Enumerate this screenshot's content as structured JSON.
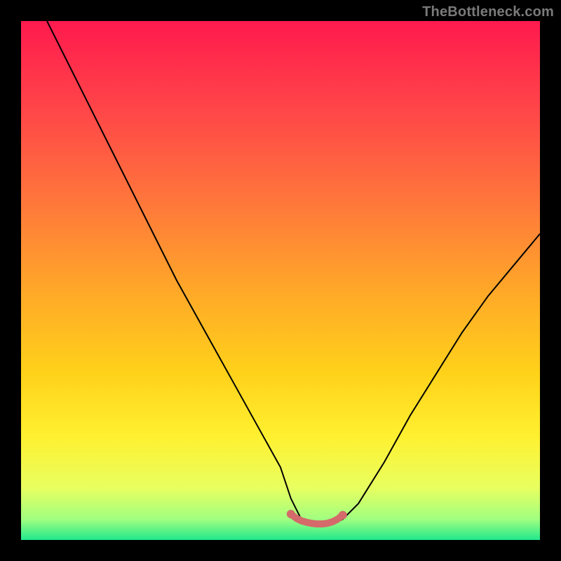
{
  "branding": {
    "watermark": "TheBottleneck.com"
  },
  "gradient": {
    "stops": [
      {
        "offset": 0,
        "color": "#ff1a4e"
      },
      {
        "offset": 18,
        "color": "#ff4848"
      },
      {
        "offset": 36,
        "color": "#ff7a3a"
      },
      {
        "offset": 52,
        "color": "#ffa828"
      },
      {
        "offset": 68,
        "color": "#ffd21a"
      },
      {
        "offset": 80,
        "color": "#fff030"
      },
      {
        "offset": 90,
        "color": "#e8ff60"
      },
      {
        "offset": 96,
        "color": "#a0ff80"
      },
      {
        "offset": 100,
        "color": "#22e88c"
      }
    ]
  },
  "chart_data": {
    "type": "line",
    "title": "",
    "xlabel": "",
    "ylabel": "",
    "xlim": [
      0,
      100
    ],
    "ylim": [
      0,
      100
    ],
    "series": [
      {
        "name": "bottleneck-curve",
        "x": [
          5,
          10,
          15,
          20,
          25,
          30,
          35,
          40,
          45,
          50,
          52,
          54,
          56,
          58,
          60,
          62,
          65,
          70,
          75,
          80,
          85,
          90,
          95,
          100
        ],
        "y": [
          100,
          90,
          80,
          70,
          60,
          50,
          41,
          32,
          23,
          14,
          8,
          4,
          3,
          3,
          3,
          4,
          7,
          15,
          24,
          32,
          40,
          47,
          53,
          59
        ]
      },
      {
        "name": "optimal-band-marker",
        "x": [
          52,
          53,
          54,
          55,
          56,
          57,
          58,
          59,
          60,
          61,
          62
        ],
        "y": [
          5.0,
          4.2,
          3.7,
          3.4,
          3.2,
          3.1,
          3.1,
          3.2,
          3.5,
          4.0,
          4.8
        ]
      }
    ],
    "marker_color": "#d46a6a",
    "curve_color": "#000000"
  }
}
